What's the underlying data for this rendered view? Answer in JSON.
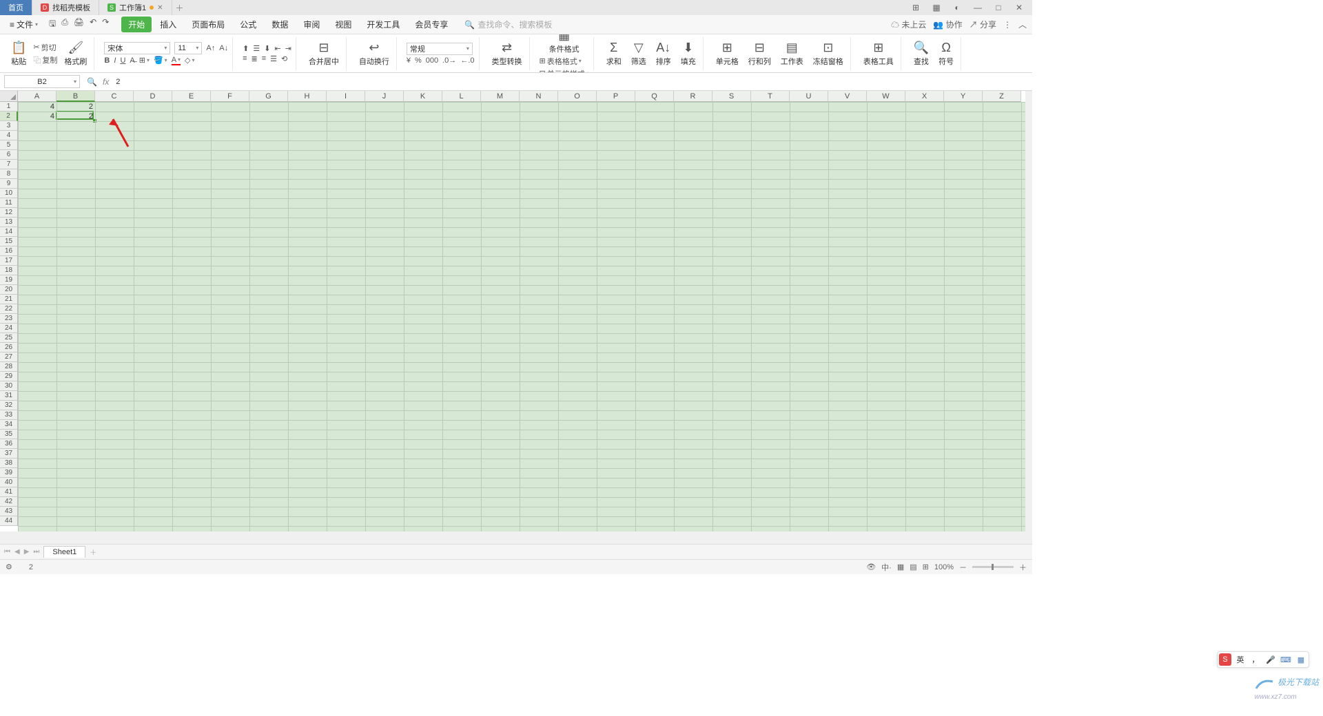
{
  "tabs": {
    "home": "首页",
    "template": "找稻壳模板",
    "workbook": "工作簿1"
  },
  "menu": {
    "file": "文件",
    "start": "开始",
    "insert": "插入",
    "layout": "页面布局",
    "formula": "公式",
    "data": "数据",
    "review": "审阅",
    "view": "视图",
    "dev": "开发工具",
    "member": "会员专享",
    "search_placeholder": "查找命令、搜索模板"
  },
  "topright": {
    "cloud": "未上云",
    "collab": "协作",
    "share": "分享"
  },
  "ribbon": {
    "paste": "粘贴",
    "cut": "剪切",
    "copy": "复制",
    "format_painter": "格式刷",
    "font_name": "宋体",
    "font_size": "11",
    "merge": "合并居中",
    "wrap": "自动换行",
    "number_format": "常规",
    "type_convert": "类型转换",
    "cond_format": "条件格式",
    "table_style": "表格格式",
    "cell_style": "单元格样式",
    "sum": "求和",
    "filter": "筛选",
    "sort": "排序",
    "fill": "填充",
    "cell": "单元格",
    "rowcol": "行和列",
    "sheet": "工作表",
    "freeze": "冻结窗格",
    "table_tool": "表格工具",
    "find": "查找",
    "symbol": "符号"
  },
  "namebox": "B2",
  "formula_value": "2",
  "columns": [
    "A",
    "B",
    "C",
    "D",
    "E",
    "F",
    "G",
    "H",
    "I",
    "J",
    "K",
    "L",
    "M",
    "N",
    "O",
    "P",
    "Q",
    "R",
    "S",
    "T",
    "U",
    "V",
    "W",
    "X",
    "Y",
    "Z"
  ],
  "cells": {
    "A1": "4",
    "B1": "2",
    "A2": "4",
    "B2": "2"
  },
  "selected": {
    "col": 1,
    "row": 1
  },
  "sheet": {
    "name": "Sheet1"
  },
  "status": {
    "value": "2",
    "zoom": "100%"
  },
  "ime": {
    "lang": "英"
  },
  "watermark": {
    "brand": "极光下载站",
    "url": "www.xz7.com"
  }
}
